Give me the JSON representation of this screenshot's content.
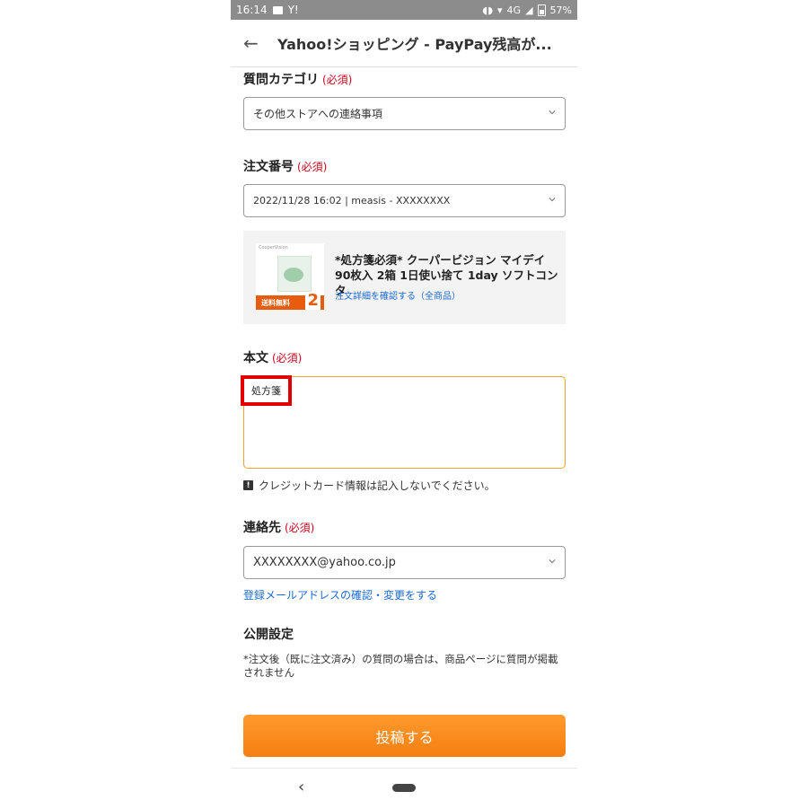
{
  "status_bar": {
    "time": "16:14",
    "carrier_icon": "Y!",
    "network": "4G",
    "battery": "57%"
  },
  "header": {
    "back_icon": "arrow-left-icon",
    "title": "Yahoo!ショッピング - PayPay残高が..."
  },
  "form": {
    "category": {
      "label": "質問カテゴリ",
      "required": "(必須)",
      "value": "その他ストアへの連絡事項"
    },
    "order": {
      "label": "注文番号",
      "required": "(必須)",
      "value": "2022/11/28 16:02 | measis - XXXXXXXX"
    },
    "product": {
      "title": "*処方箋必須* クーパービジョン マイデイ 90枚入 2箱 1日使い捨て 1day ソフトコンタ",
      "link": "注文詳細を確認する（全商品）",
      "thumb_logo": "CooperVision",
      "thumb_ribbon": "送料無料",
      "thumb_count": "2"
    },
    "body": {
      "label": "本文",
      "required": "(必須)",
      "value": "処方箋"
    },
    "warning": "クレジットカード情報は記入しないでください。",
    "contact": {
      "label": "連絡先",
      "required": "(必須)",
      "value": "XXXXXXXX@yahoo.co.jp",
      "link": "登録メールアドレスの確認・変更をする"
    },
    "visibility": {
      "label": "公開設定",
      "note": "*注文後（既に注文済み）の質問の場合は、商品ページに質問が掲載されません"
    },
    "submit": "投稿する"
  },
  "colors": {
    "accent": "#f57e10",
    "required": "#d0021b",
    "link": "#1c69d4",
    "highlight": "#e00000"
  }
}
